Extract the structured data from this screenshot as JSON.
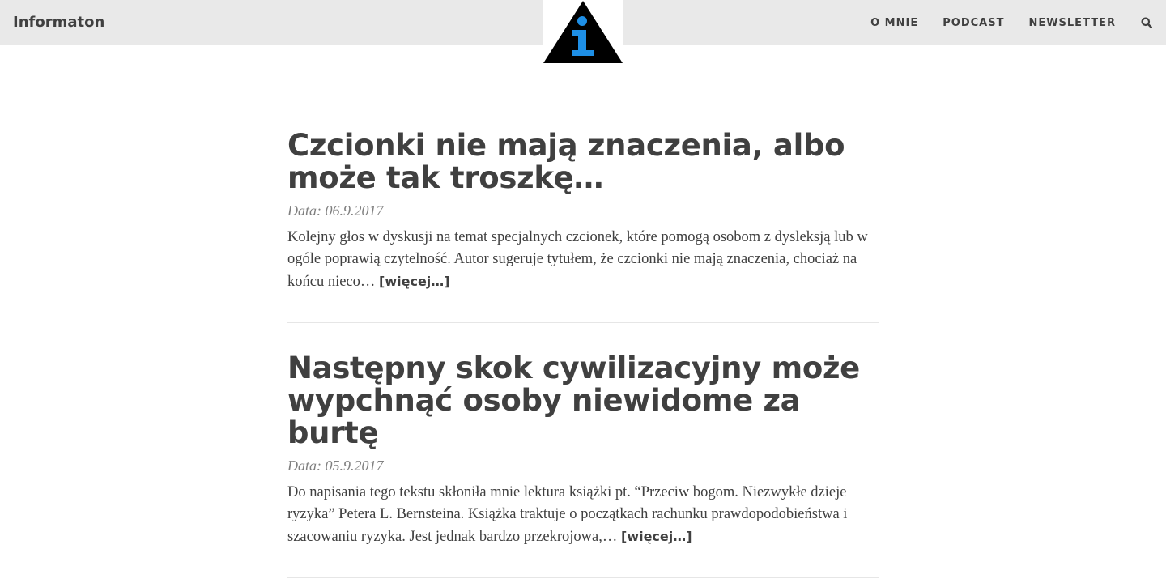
{
  "header": {
    "brand": "Informaton",
    "logo_icon": "info-triangle-icon",
    "nav": [
      {
        "label": "O MNIE"
      },
      {
        "label": "PODCAST"
      },
      {
        "label": "NEWSLETTER"
      }
    ],
    "search_icon": "search-icon"
  },
  "posts": [
    {
      "title": "Czcionki nie mają znaczenia, albo może tak troszkę…",
      "date": "Data: 06.9.2017",
      "excerpt": "Kolejny głos w dyskusji na temat specjalnych czcionek, które pomogą osobom z dysleksją lub w ogóle poprawią czytelność. Autor sugeruje tytułem, że czcionki nie mają znaczenia, chociaż na końcu nieco…",
      "more": "[więcej…]"
    },
    {
      "title": "Następny skok cywilizacyjny może wypchnąć osoby niewidome za burtę",
      "date": "Data: 05.9.2017",
      "excerpt": "Do napisania tego tekstu skłoniła mnie lektura książki pt. “Przeciw bogom. Niezwykłe dzieje ryzyka” Petera L. Bernsteina. Książka traktuje o początkach rachunku prawdopodobieństwa i szacowaniu ryzyka. Jest jednak bardzo przekrojowa,…",
      "more": "[więcej…]"
    }
  ],
  "colors": {
    "topbar": "#e9e9e9",
    "text": "#404040",
    "meta": "#808080",
    "logo_triangle": "#000000",
    "logo_i": "#1e8fe6"
  }
}
